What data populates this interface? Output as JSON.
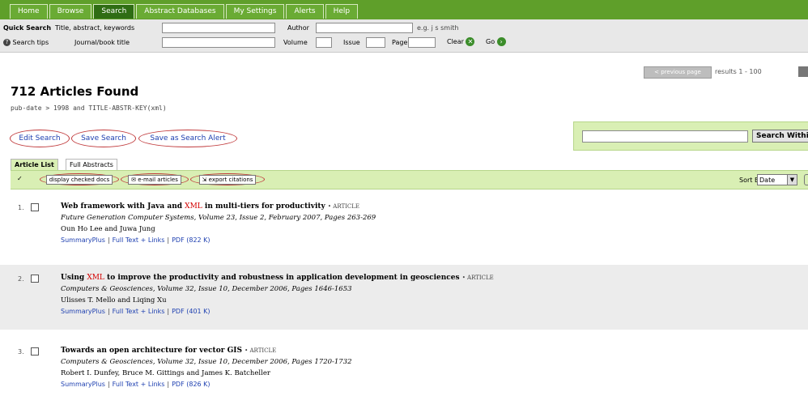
{
  "nav": {
    "tabs": [
      {
        "label": "Home"
      },
      {
        "label": "Browse"
      },
      {
        "label": "Search"
      },
      {
        "label": "Abstract Databases"
      },
      {
        "label": "My Settings"
      },
      {
        "label": "Alerts"
      },
      {
        "label": "Help"
      }
    ],
    "active_tab": "Search"
  },
  "quick_search": {
    "title": "Quick Search",
    "title_label": "Title, abstract, keywords",
    "author_label": "Author",
    "author_hint": "e.g. j s smith",
    "tips_label": "Search tips",
    "journal_label": "Journal/book title",
    "volume_label": "Volume",
    "issue_label": "Issue",
    "page_label": "Page",
    "clear_label": "Clear",
    "go_label": "Go"
  },
  "pagination": {
    "previous_label": "< previous page",
    "results_label": "results 1 - 100"
  },
  "summary": {
    "count_text": "712 Articles Found",
    "query_text": "pub-date > 1998 and TITLE-ABSTR-KEY(xml)"
  },
  "actions": {
    "edit_search": "Edit Search",
    "save_search": "Save Search",
    "save_alert": "Save as Search Alert"
  },
  "search_within": {
    "button_label": "Search Within"
  },
  "result_tabs": {
    "article_list": "Article List",
    "full_abstracts": "Full Abstracts"
  },
  "toolbar": {
    "display_checked": "display checked docs",
    "email_articles": "e-mail articles",
    "export_citations": "export citations",
    "sort_label": "Sort By:",
    "sort_value": "Date"
  },
  "articles": [
    {
      "num": "1.",
      "title_pre": "Web framework with Java and ",
      "title_hl": "XML",
      "title_post": " in multi-tiers for productivity",
      "type": "• ARTICLE",
      "source": "Future Generation Computer Systems, Volume 23, Issue 2, February 2007, Pages 263-269",
      "authors": "Oun Ho Lee and Juwa Jung",
      "links": {
        "summary": "SummaryPlus",
        "fulltext": "Full Text + Links",
        "pdf": "PDF (822 K)"
      }
    },
    {
      "num": "2.",
      "title_pre": "Using ",
      "title_hl": "XML",
      "title_post": " to improve the productivity and robustness in application development in geosciences",
      "type": "• ARTICLE",
      "source": "Computers & Geosciences, Volume 32, Issue 10, December 2006, Pages 1646-1653",
      "authors": "Ulisses T. Mello and Liqing Xu",
      "links": {
        "summary": "SummaryPlus",
        "fulltext": "Full Text + Links",
        "pdf": "PDF (401 K)"
      }
    },
    {
      "num": "3.",
      "title_pre": "Towards an open architecture for vector GIS",
      "title_hl": "",
      "title_post": "",
      "type": "• ARTICLE",
      "source": "Computers & Geosciences, Volume 32, Issue 10, December 2006, Pages 1720-1732",
      "authors": "Robert I. Dunfey, Bruce M. Gittings and James K. Batcheller",
      "links": {
        "summary": "SummaryPlus",
        "fulltext": "Full Text + Links",
        "pdf": "PDF (826 K)"
      }
    }
  ],
  "colors": {
    "nav_green": "#5f9f2a",
    "toolbar_green": "#d9efb4",
    "link_blue": "#1d3fb0",
    "highlight_red": "#d30000",
    "oval_red": "#c0393b"
  }
}
